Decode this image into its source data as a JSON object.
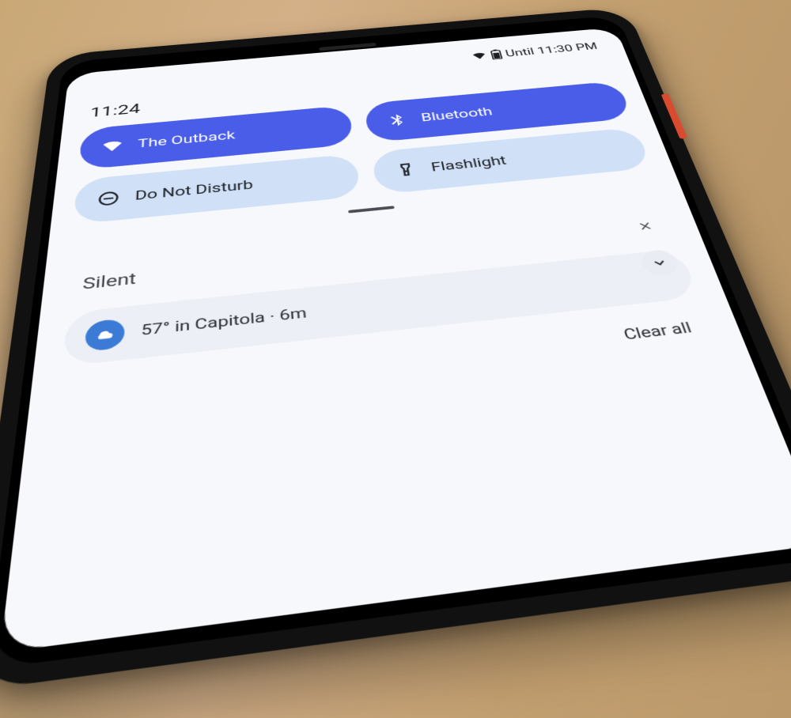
{
  "status": {
    "alarm_text": "Until 11:30 PM"
  },
  "clock": "11:24",
  "tiles": {
    "wifi": {
      "label": "The Outback"
    },
    "bluetooth": {
      "label": "Bluetooth"
    },
    "dnd": {
      "label": "Do Not Disturb"
    },
    "flashlight": {
      "label": "Flashlight"
    }
  },
  "silent_label": "Silent",
  "notification": {
    "text": "57° in Capitola · 6m"
  },
  "clear_all_label": "Clear all"
}
